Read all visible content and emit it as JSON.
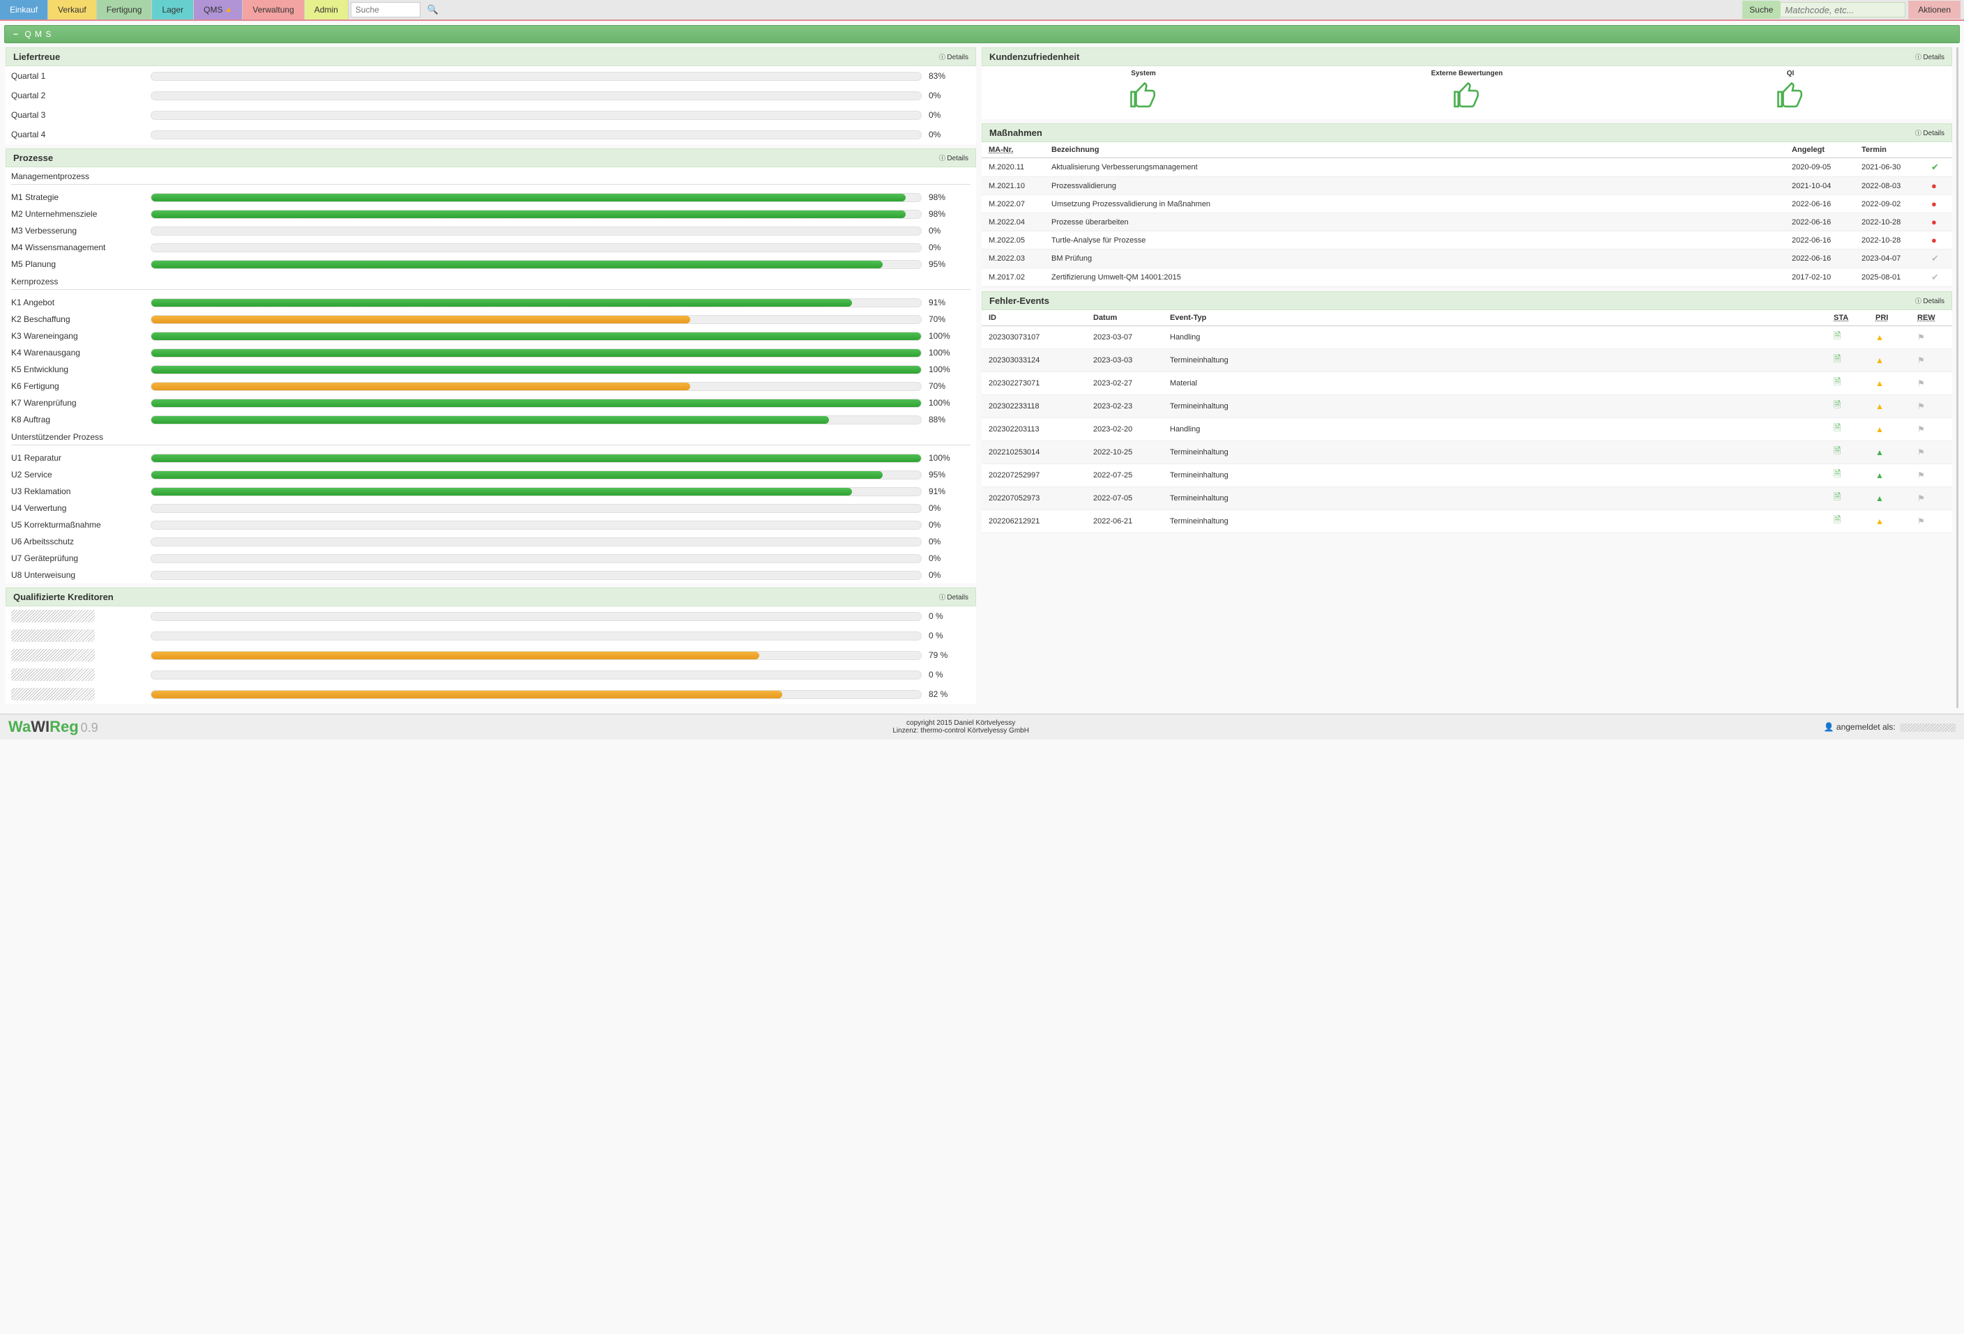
{
  "nav": {
    "einkauf": "Einkauf",
    "verkauf": "Verkauf",
    "fertigung": "Fertigung",
    "lager": "Lager",
    "qms": "QMS",
    "verwaltung": "Verwaltung",
    "admin": "Admin",
    "search_placeholder": "Suche",
    "search_right_label": "Suche",
    "search_right_placeholder": "Matchcode, etc...",
    "aktionen": "Aktionen"
  },
  "qmsbar": {
    "label": "Q M S"
  },
  "details_label": "Details",
  "liefertreue": {
    "title": "Liefertreue",
    "rows": [
      {
        "label": "Quartal 1",
        "pct": 83,
        "color": "orange"
      },
      {
        "label": "Quartal 2",
        "pct": 0
      },
      {
        "label": "Quartal 3",
        "pct": 0
      },
      {
        "label": "Quartal 4",
        "pct": 0
      }
    ]
  },
  "prozesse": {
    "title": "Prozesse",
    "groups": [
      {
        "title": "Managementprozess",
        "rows": [
          {
            "label": "M1 Strategie",
            "pct": 98,
            "color": "green"
          },
          {
            "label": "M2 Unternehmensziele",
            "pct": 98,
            "color": "green"
          },
          {
            "label": "M3 Verbesserung",
            "pct": 0
          },
          {
            "label": "M4 Wissensmanagement",
            "pct": 0
          },
          {
            "label": "M5 Planung",
            "pct": 95,
            "color": "green"
          }
        ]
      },
      {
        "title": "Kernprozess",
        "rows": [
          {
            "label": "K1 Angebot",
            "pct": 91,
            "color": "green"
          },
          {
            "label": "K2 Beschaffung",
            "pct": 70,
            "color": "orange"
          },
          {
            "label": "K3 Wareneingang",
            "pct": 100,
            "color": "green"
          },
          {
            "label": "K4 Warenausgang",
            "pct": 100,
            "color": "green"
          },
          {
            "label": "K5 Entwicklung",
            "pct": 100,
            "color": "green"
          },
          {
            "label": "K6 Fertigung",
            "pct": 70,
            "color": "orange"
          },
          {
            "label": "K7 Warenprüfung",
            "pct": 100,
            "color": "green"
          },
          {
            "label": "K8 Auftrag",
            "pct": 88,
            "color": "green"
          }
        ]
      },
      {
        "title": "Unterstützender Prozess",
        "rows": [
          {
            "label": "U1 Reparatur",
            "pct": 100,
            "color": "green"
          },
          {
            "label": "U2 Service",
            "pct": 95,
            "color": "green"
          },
          {
            "label": "U3 Reklamation",
            "pct": 91,
            "color": "green"
          },
          {
            "label": "U4 Verwertung",
            "pct": 0
          },
          {
            "label": "U5 Korrekturmaßnahme",
            "pct": 0
          },
          {
            "label": "U6 Arbeitsschutz",
            "pct": 0
          },
          {
            "label": "U7 Geräteprüfung",
            "pct": 0
          },
          {
            "label": "U8 Unterweisung",
            "pct": 0
          }
        ]
      }
    ]
  },
  "kreditoren": {
    "title": "Qualifizierte Kreditoren",
    "rows": [
      {
        "pct": 0
      },
      {
        "pct": 0
      },
      {
        "pct": 79,
        "color": "orange"
      },
      {
        "pct": 0
      },
      {
        "pct": 82,
        "color": "orange"
      }
    ]
  },
  "kunden": {
    "title": "Kundenzufriedenheit",
    "items": [
      {
        "label": "System"
      },
      {
        "label": "Externe Bewertungen"
      },
      {
        "label": "QI"
      }
    ]
  },
  "massnahmen": {
    "title": "Maßnahmen",
    "headers": {
      "nr": "MA-Nr.",
      "bez": "Bezeichnung",
      "ang": "Angelegt",
      "ter": "Termin"
    },
    "rows": [
      {
        "nr": "M.2020.11",
        "bez": "Aktualisierung Verbesserungsmanagement",
        "ang": "2020-09-05",
        "ter": "2021-06-30",
        "status": "ok"
      },
      {
        "nr": "M.2021.10",
        "bez": "Prozessvalidierung",
        "ang": "2021-10-04",
        "ter": "2022-08-03",
        "status": "warn"
      },
      {
        "nr": "M.2022.07",
        "bez": "Umsetzung Prozessvalidierung in Maßnahmen",
        "ang": "2022-06-16",
        "ter": "2022-09-02",
        "status": "warn"
      },
      {
        "nr": "M.2022.04",
        "bez": "Prozesse überarbeiten",
        "ang": "2022-06-16",
        "ter": "2022-10-28",
        "status": "warn"
      },
      {
        "nr": "M.2022.05",
        "bez": "Turtle-Analyse für Prozesse",
        "ang": "2022-06-16",
        "ter": "2022-10-28",
        "status": "warn"
      },
      {
        "nr": "M.2022.03",
        "bez": "BM Prüfung",
        "ang": "2022-06-16",
        "ter": "2023-04-07",
        "status": "grey"
      },
      {
        "nr": "M.2017.02",
        "bez": "Zertifizierung Umwelt-QM 14001:2015",
        "ang": "2017-02-10",
        "ter": "2025-08-01",
        "status": "grey"
      }
    ]
  },
  "fehler": {
    "title": "Fehler-Events",
    "headers": {
      "id": "ID",
      "datum": "Datum",
      "typ": "Event-Typ",
      "sta": "STA",
      "pri": "PRI",
      "rew": "REW"
    },
    "rows": [
      {
        "id": "202303073107",
        "datum": "2023-03-07",
        "typ": "Handling",
        "pri": "y"
      },
      {
        "id": "202303033124",
        "datum": "2023-03-03",
        "typ": "Termineinhaltung",
        "pri": "y"
      },
      {
        "id": "202302273071",
        "datum": "2023-02-27",
        "typ": "Material",
        "pri": "y"
      },
      {
        "id": "202302233118",
        "datum": "2023-02-23",
        "typ": "Termineinhaltung",
        "pri": "y"
      },
      {
        "id": "202302203113",
        "datum": "2023-02-20",
        "typ": "Handling",
        "pri": "y"
      },
      {
        "id": "202210253014",
        "datum": "2022-10-25",
        "typ": "Termineinhaltung",
        "pri": "g"
      },
      {
        "id": "202207252997",
        "datum": "2022-07-25",
        "typ": "Termineinhaltung",
        "pri": "g"
      },
      {
        "id": "202207052973",
        "datum": "2022-07-05",
        "typ": "Termineinhaltung",
        "pri": "g"
      },
      {
        "id": "202206212921",
        "datum": "2022-06-21",
        "typ": "Termineinhaltung",
        "pri": "y"
      }
    ]
  },
  "footer": {
    "app": "WaWIReg",
    "ver": "0.9",
    "copy1": "copyright 2015 Daniel Körtvelyessy",
    "copy2": "Linzenz:  thermo-control Körtvelyessy GmbH",
    "login": "angemeldet als:"
  },
  "chart_data": [
    {
      "type": "bar",
      "title": "Liefertreue",
      "categories": [
        "Quartal 1",
        "Quartal 2",
        "Quartal 3",
        "Quartal 4"
      ],
      "values": [
        83,
        0,
        0,
        0
      ],
      "xlabel": "",
      "ylabel": "%",
      "ylim": [
        0,
        100
      ]
    },
    {
      "type": "bar",
      "title": "Managementprozess",
      "categories": [
        "M1 Strategie",
        "M2 Unternehmensziele",
        "M3 Verbesserung",
        "M4 Wissensmanagement",
        "M5 Planung"
      ],
      "values": [
        98,
        98,
        0,
        0,
        95
      ],
      "xlabel": "",
      "ylabel": "%",
      "ylim": [
        0,
        100
      ]
    },
    {
      "type": "bar",
      "title": "Kernprozess",
      "categories": [
        "K1 Angebot",
        "K2 Beschaffung",
        "K3 Wareneingang",
        "K4 Warenausgang",
        "K5 Entwicklung",
        "K6 Fertigung",
        "K7 Warenprüfung",
        "K8 Auftrag"
      ],
      "values": [
        91,
        70,
        100,
        100,
        100,
        70,
        100,
        88
      ],
      "xlabel": "",
      "ylabel": "%",
      "ylim": [
        0,
        100
      ]
    },
    {
      "type": "bar",
      "title": "Unterstützender Prozess",
      "categories": [
        "U1 Reparatur",
        "U2 Service",
        "U3 Reklamation",
        "U4 Verwertung",
        "U5 Korrekturmaßnahme",
        "U6 Arbeitsschutz",
        "U7 Geräteprüfung",
        "U8 Unterweisung"
      ],
      "values": [
        100,
        95,
        91,
        0,
        0,
        0,
        0,
        0
      ],
      "xlabel": "",
      "ylabel": "%",
      "ylim": [
        0,
        100
      ]
    },
    {
      "type": "bar",
      "title": "Qualifizierte Kreditoren",
      "categories": [
        "K1",
        "K2",
        "K3",
        "K4",
        "K5"
      ],
      "values": [
        0,
        0,
        79,
        0,
        82
      ],
      "xlabel": "",
      "ylabel": "%",
      "ylim": [
        0,
        100
      ]
    }
  ]
}
